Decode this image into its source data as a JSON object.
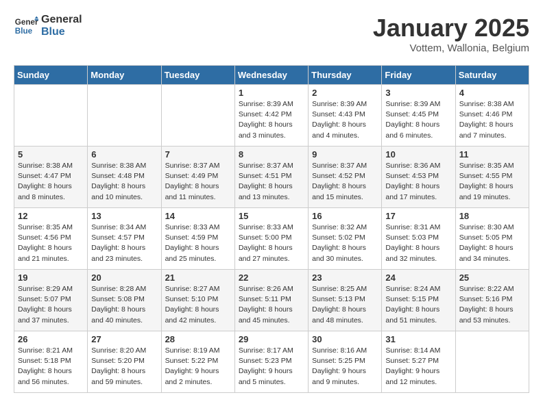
{
  "header": {
    "logo_line1": "General",
    "logo_line2": "Blue",
    "month": "January 2025",
    "location": "Vottem, Wallonia, Belgium"
  },
  "weekdays": [
    "Sunday",
    "Monday",
    "Tuesday",
    "Wednesday",
    "Thursday",
    "Friday",
    "Saturday"
  ],
  "weeks": [
    [
      {
        "day": "",
        "info": ""
      },
      {
        "day": "",
        "info": ""
      },
      {
        "day": "",
        "info": ""
      },
      {
        "day": "1",
        "info": "Sunrise: 8:39 AM\nSunset: 4:42 PM\nDaylight: 8 hours\nand 3 minutes."
      },
      {
        "day": "2",
        "info": "Sunrise: 8:39 AM\nSunset: 4:43 PM\nDaylight: 8 hours\nand 4 minutes."
      },
      {
        "day": "3",
        "info": "Sunrise: 8:39 AM\nSunset: 4:45 PM\nDaylight: 8 hours\nand 6 minutes."
      },
      {
        "day": "4",
        "info": "Sunrise: 8:38 AM\nSunset: 4:46 PM\nDaylight: 8 hours\nand 7 minutes."
      }
    ],
    [
      {
        "day": "5",
        "info": "Sunrise: 8:38 AM\nSunset: 4:47 PM\nDaylight: 8 hours\nand 8 minutes."
      },
      {
        "day": "6",
        "info": "Sunrise: 8:38 AM\nSunset: 4:48 PM\nDaylight: 8 hours\nand 10 minutes."
      },
      {
        "day": "7",
        "info": "Sunrise: 8:37 AM\nSunset: 4:49 PM\nDaylight: 8 hours\nand 11 minutes."
      },
      {
        "day": "8",
        "info": "Sunrise: 8:37 AM\nSunset: 4:51 PM\nDaylight: 8 hours\nand 13 minutes."
      },
      {
        "day": "9",
        "info": "Sunrise: 8:37 AM\nSunset: 4:52 PM\nDaylight: 8 hours\nand 15 minutes."
      },
      {
        "day": "10",
        "info": "Sunrise: 8:36 AM\nSunset: 4:53 PM\nDaylight: 8 hours\nand 17 minutes."
      },
      {
        "day": "11",
        "info": "Sunrise: 8:35 AM\nSunset: 4:55 PM\nDaylight: 8 hours\nand 19 minutes."
      }
    ],
    [
      {
        "day": "12",
        "info": "Sunrise: 8:35 AM\nSunset: 4:56 PM\nDaylight: 8 hours\nand 21 minutes."
      },
      {
        "day": "13",
        "info": "Sunrise: 8:34 AM\nSunset: 4:57 PM\nDaylight: 8 hours\nand 23 minutes."
      },
      {
        "day": "14",
        "info": "Sunrise: 8:33 AM\nSunset: 4:59 PM\nDaylight: 8 hours\nand 25 minutes."
      },
      {
        "day": "15",
        "info": "Sunrise: 8:33 AM\nSunset: 5:00 PM\nDaylight: 8 hours\nand 27 minutes."
      },
      {
        "day": "16",
        "info": "Sunrise: 8:32 AM\nSunset: 5:02 PM\nDaylight: 8 hours\nand 30 minutes."
      },
      {
        "day": "17",
        "info": "Sunrise: 8:31 AM\nSunset: 5:03 PM\nDaylight: 8 hours\nand 32 minutes."
      },
      {
        "day": "18",
        "info": "Sunrise: 8:30 AM\nSunset: 5:05 PM\nDaylight: 8 hours\nand 34 minutes."
      }
    ],
    [
      {
        "day": "19",
        "info": "Sunrise: 8:29 AM\nSunset: 5:07 PM\nDaylight: 8 hours\nand 37 minutes."
      },
      {
        "day": "20",
        "info": "Sunrise: 8:28 AM\nSunset: 5:08 PM\nDaylight: 8 hours\nand 40 minutes."
      },
      {
        "day": "21",
        "info": "Sunrise: 8:27 AM\nSunset: 5:10 PM\nDaylight: 8 hours\nand 42 minutes."
      },
      {
        "day": "22",
        "info": "Sunrise: 8:26 AM\nSunset: 5:11 PM\nDaylight: 8 hours\nand 45 minutes."
      },
      {
        "day": "23",
        "info": "Sunrise: 8:25 AM\nSunset: 5:13 PM\nDaylight: 8 hours\nand 48 minutes."
      },
      {
        "day": "24",
        "info": "Sunrise: 8:24 AM\nSunset: 5:15 PM\nDaylight: 8 hours\nand 51 minutes."
      },
      {
        "day": "25",
        "info": "Sunrise: 8:22 AM\nSunset: 5:16 PM\nDaylight: 8 hours\nand 53 minutes."
      }
    ],
    [
      {
        "day": "26",
        "info": "Sunrise: 8:21 AM\nSunset: 5:18 PM\nDaylight: 8 hours\nand 56 minutes."
      },
      {
        "day": "27",
        "info": "Sunrise: 8:20 AM\nSunset: 5:20 PM\nDaylight: 8 hours\nand 59 minutes."
      },
      {
        "day": "28",
        "info": "Sunrise: 8:19 AM\nSunset: 5:22 PM\nDaylight: 9 hours\nand 2 minutes."
      },
      {
        "day": "29",
        "info": "Sunrise: 8:17 AM\nSunset: 5:23 PM\nDaylight: 9 hours\nand 5 minutes."
      },
      {
        "day": "30",
        "info": "Sunrise: 8:16 AM\nSunset: 5:25 PM\nDaylight: 9 hours\nand 9 minutes."
      },
      {
        "day": "31",
        "info": "Sunrise: 8:14 AM\nSunset: 5:27 PM\nDaylight: 9 hours\nand 12 minutes."
      },
      {
        "day": "",
        "info": ""
      }
    ]
  ]
}
